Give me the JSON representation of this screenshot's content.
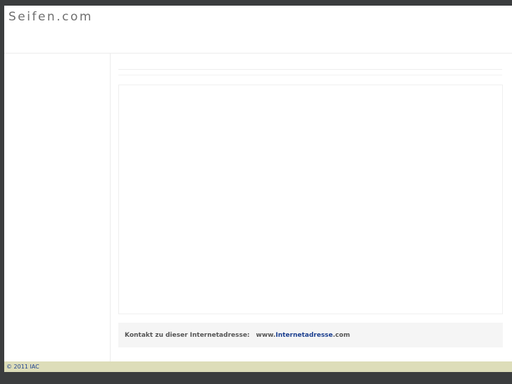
{
  "header": {
    "title": "Seifen.com"
  },
  "contact": {
    "label": "Kontakt zu dieser Internetadresse:",
    "prefix": "www.",
    "link": "Internetadresse",
    "suffix": ".com"
  },
  "footer": {
    "copyright": "© 2011 IAC"
  },
  "colors": {
    "background": "#3b3d3e",
    "footer": "#ddddb9",
    "link": "#1b3f8f"
  }
}
